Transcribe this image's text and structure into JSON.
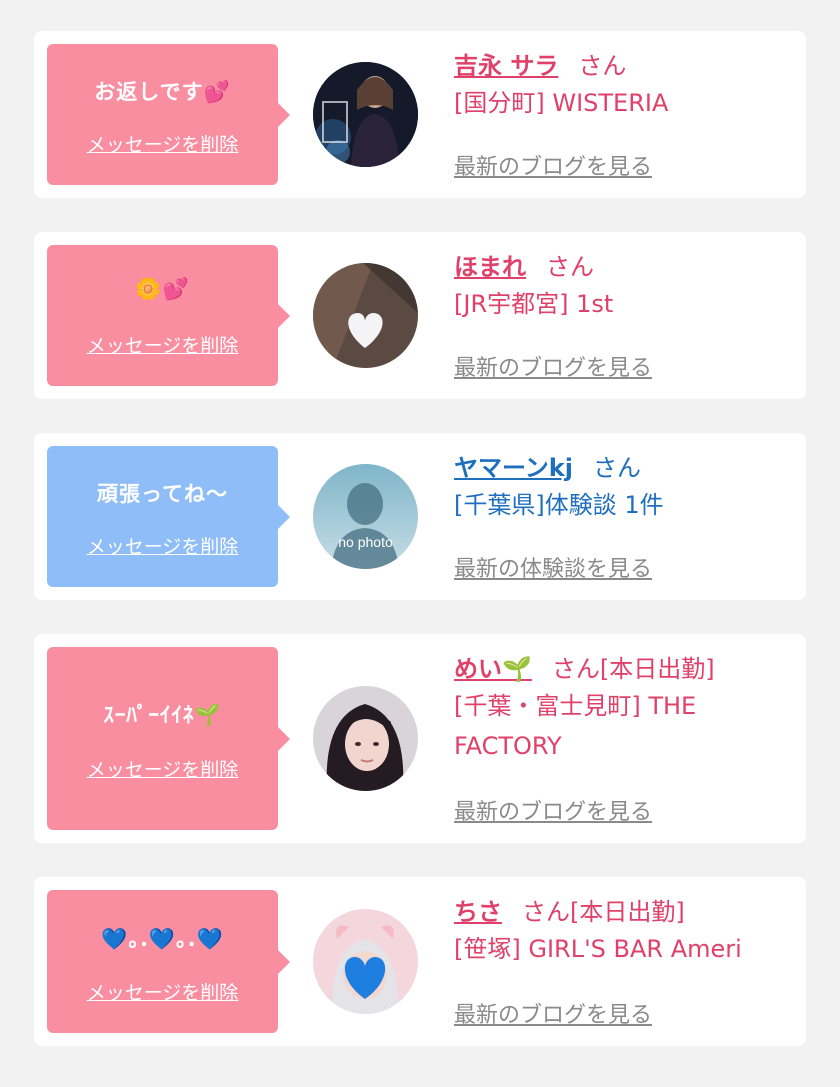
{
  "delete_label": "メッセージを削除",
  "colors": {
    "pink_bubble": "#f98ea1",
    "blue_bubble": "#8fbdf7",
    "pink_text": "#e0416a",
    "blue_text": "#1f6fbf",
    "link_gray": "#8a8a8a"
  },
  "entries": [
    {
      "message": "お返しです💕",
      "name": "吉永 サラ",
      "suffix": "さん",
      "shop_line1": "[国分町] WISTERIA",
      "shop_line2": "",
      "link": "最新のブログを見る",
      "bubble_color": "pink",
      "avatar_icon": "woman-photo-avatar"
    },
    {
      "message": "🌼💕",
      "name": "ほまれ",
      "suffix": "さん",
      "shop_line1": "[JR宇都宮] 1st",
      "shop_line2": "",
      "link": "最新のブログを見る",
      "bubble_color": "pink",
      "avatar_icon": "heart-photo-avatar"
    },
    {
      "message": "頑張ってね〜",
      "name": "ヤマーンkj",
      "suffix": "さん",
      "shop_line1": "[千葉県]体験談 1件",
      "shop_line2": "",
      "link": "最新の体験談を見る",
      "bubble_color": "blue",
      "avatar_icon": "no-photo-avatar",
      "avatar_text": "no photo"
    },
    {
      "message": "ｽｰﾊﾟｰｲｲﾈ🌱",
      "name": "めい🌱",
      "suffix": "さん[本日出勤]",
      "shop_line1": "[千葉・富士見町] THE",
      "shop_line2": "FACTORY",
      "link": "最新のブログを見る",
      "bubble_color": "pink",
      "avatar_icon": "woman-photo-avatar"
    },
    {
      "message": "💙｡.💙｡.💙",
      "name": "ちさ",
      "suffix": "さん[本日出勤]",
      "shop_line1": "[笹塚] GIRL'S BAR Ameri",
      "shop_line2": "",
      "link": "最新のブログを見る",
      "bubble_color": "pink",
      "avatar_icon": "blue-heart-photo-avatar"
    }
  ]
}
